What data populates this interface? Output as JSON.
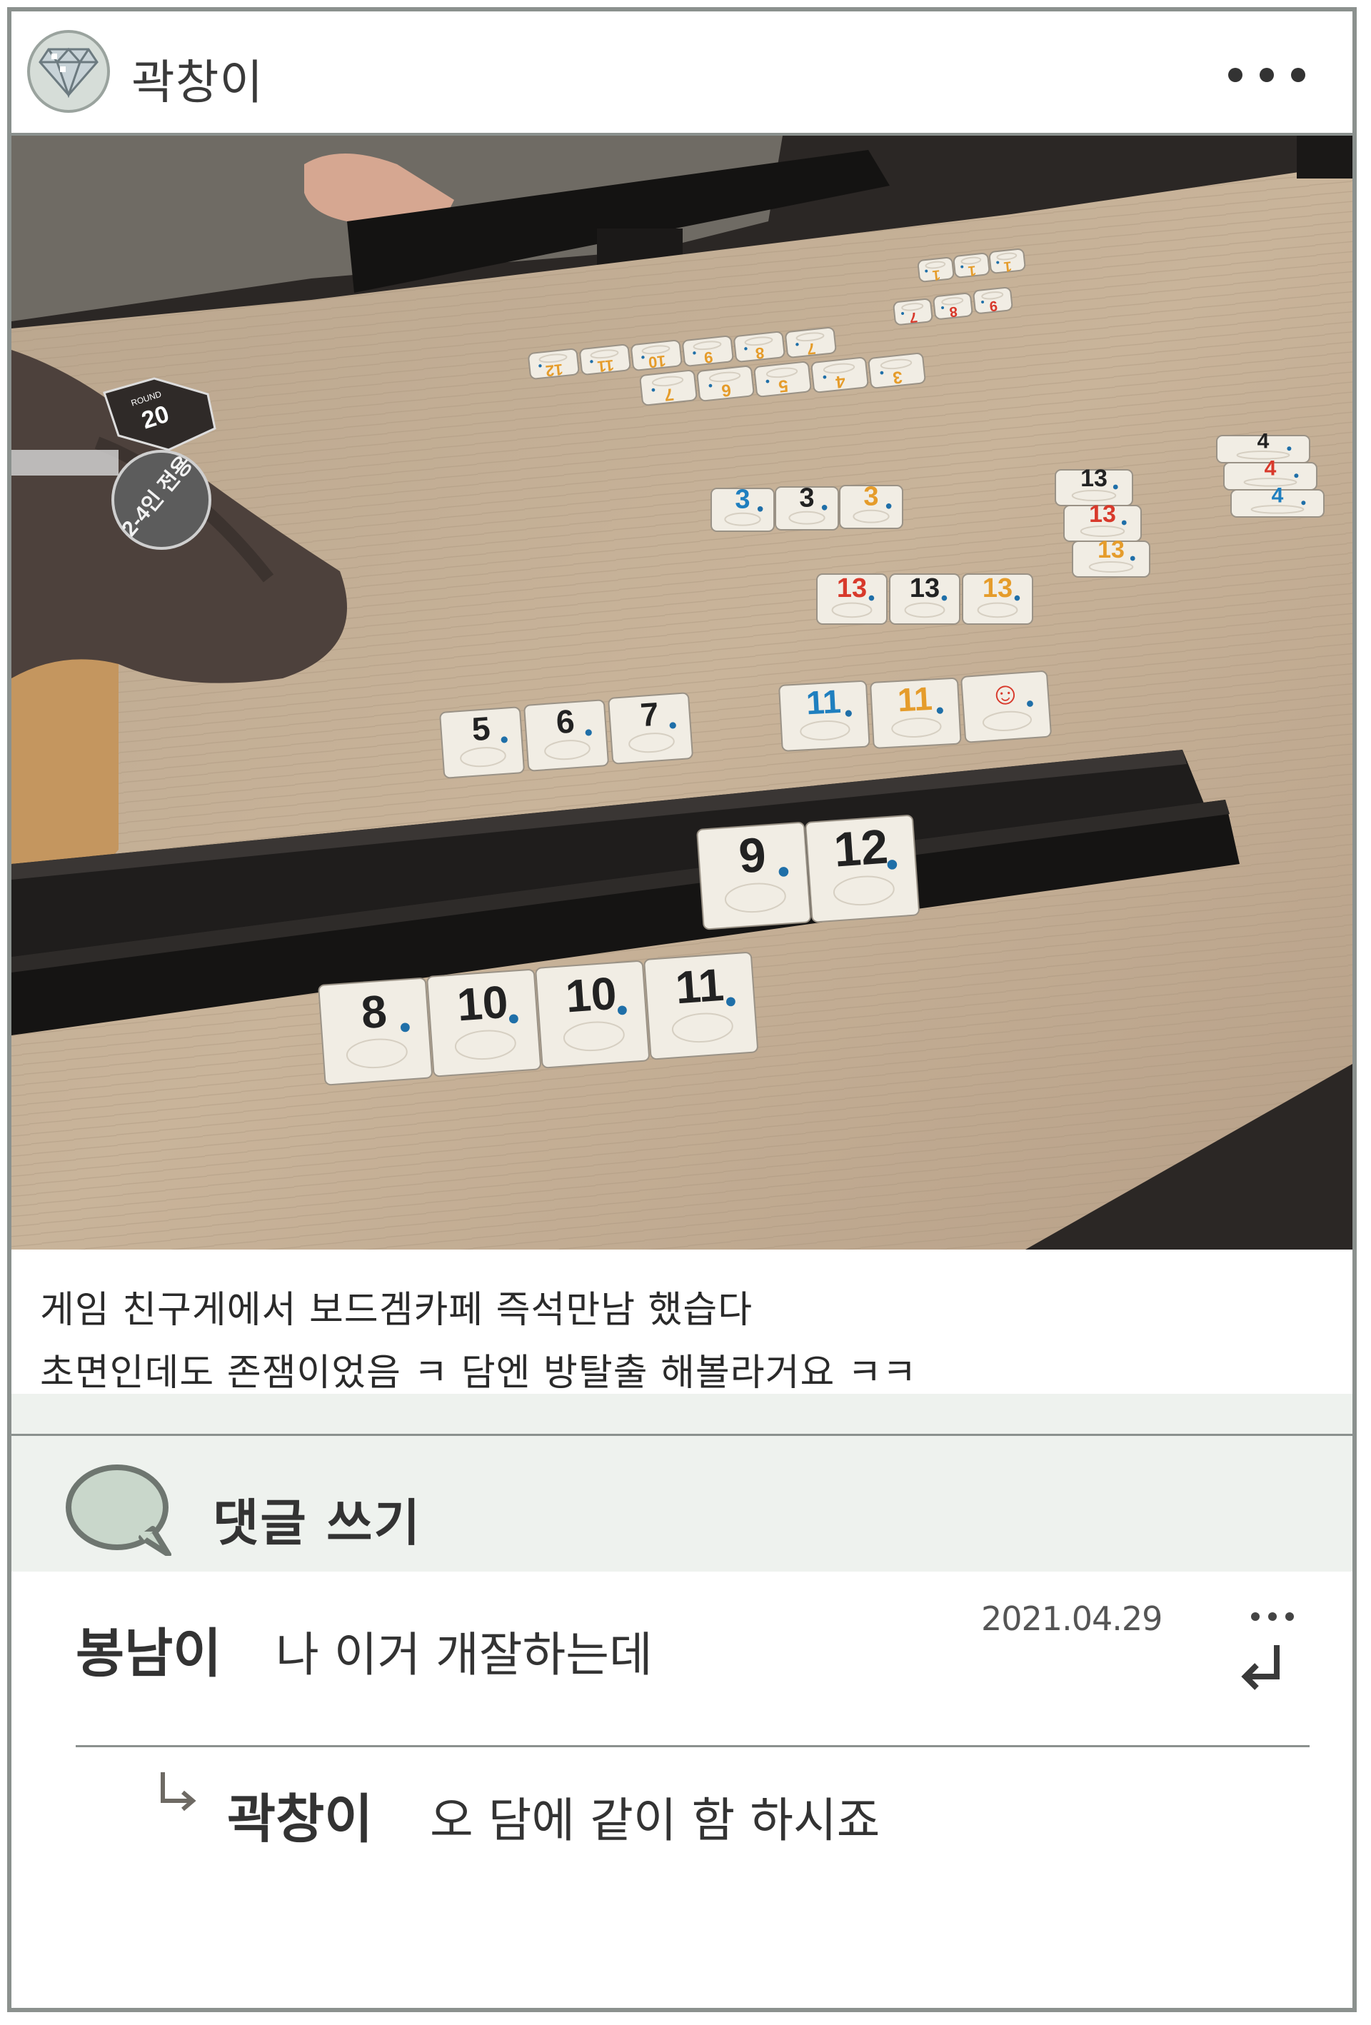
{
  "header": {
    "username": "곽창이",
    "avatar_icon": "diamond-icon",
    "more_icon": "more-dots-icon"
  },
  "photo": {
    "tiles_top_row_a": [
      "1",
      "1",
      "1"
    ],
    "tiles_top_row_b": [
      "7",
      "8",
      "9"
    ],
    "tiles_row_c": [
      "12",
      "11",
      "10",
      "9",
      "8",
      "7"
    ],
    "tiles_row_d": [
      "7",
      "6",
      "5",
      "4",
      "3"
    ],
    "tiles_threes": [
      "3",
      "3",
      "3"
    ],
    "tiles_thirteens_a": [
      "13",
      "13",
      "13"
    ],
    "tiles_thirteens_b": [
      "13",
      "13",
      "13"
    ],
    "tiles_fours": [
      "4",
      "4",
      "4"
    ],
    "tiles_run_567": [
      "5",
      "6",
      "7"
    ],
    "tiles_elevens": [
      "11",
      "11"
    ],
    "rack_top": [
      "9",
      "12"
    ],
    "rack_bottom": [
      "8",
      "10",
      "10",
      "11"
    ],
    "sign_badge": "2-4인 전용",
    "sign_number": "20",
    "sign_small": "ROUND"
  },
  "caption": {
    "line1": "게임 친구게에서 보드겜카페 즉석만남 했습다",
    "line2": "초면인데도 존잼이었음 ㅋ 담엔 방탈출 해볼라거요 ㅋㅋ"
  },
  "comment_box": {
    "label": "댓글 쓰기",
    "icon": "speech-bubble-icon"
  },
  "comments": [
    {
      "author": "봉남이",
      "text": "나 이거 개잘하는데",
      "date": "2021.04.29"
    }
  ],
  "replies": [
    {
      "author": "곽창이",
      "text": "오 담에 같이 함 하시죠"
    }
  ],
  "colors": {
    "border": "#8b918e",
    "band": "#eef2ee",
    "bubble_fill": "#c9d7cb"
  }
}
